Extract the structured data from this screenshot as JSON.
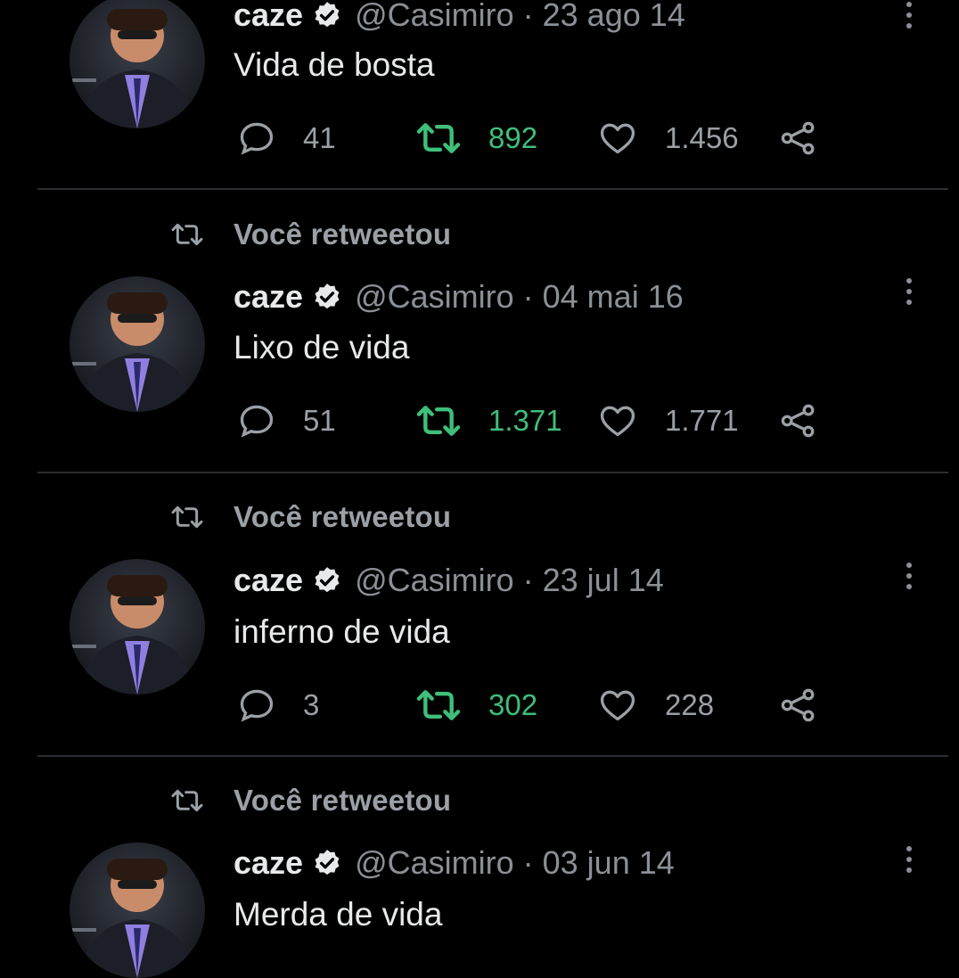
{
  "timeline": {
    "tweets": [
      {
        "retweet_label": "",
        "author_name": "caze",
        "handle": "@Casimiro",
        "separator": "·",
        "date": "23 ago 14",
        "text": "Vida de bosta",
        "replies": "41",
        "retweets": "892",
        "likes": "1.456"
      },
      {
        "retweet_label": "Você retweetou",
        "author_name": "caze",
        "handle": "@Casimiro",
        "separator": "·",
        "date": "04 mai 16",
        "text": "Lixo de vida",
        "replies": "51",
        "retweets": "1.371",
        "likes": "1.771"
      },
      {
        "retweet_label": "Você retweetou",
        "author_name": "caze",
        "handle": "@Casimiro",
        "separator": "·",
        "date": "23 jul 14",
        "text": "inferno de vida",
        "replies": "3",
        "retweets": "302",
        "likes": "228"
      },
      {
        "retweet_label": "Você retweetou",
        "author_name": "caze",
        "handle": "@Casimiro",
        "separator": "·",
        "date": "03 jun 14",
        "text": "Merda de vida"
      }
    ]
  },
  "icons": {
    "reply": "reply-icon",
    "retweet": "retweet-icon",
    "like": "heart-icon",
    "share": "share-icon",
    "verified": "verified-badge-icon",
    "more": "more-options-icon"
  },
  "colors": {
    "background": "#000000",
    "text": "#e7e9ea",
    "muted": "#8b9096",
    "retweet_active": "#3fbf7a"
  }
}
